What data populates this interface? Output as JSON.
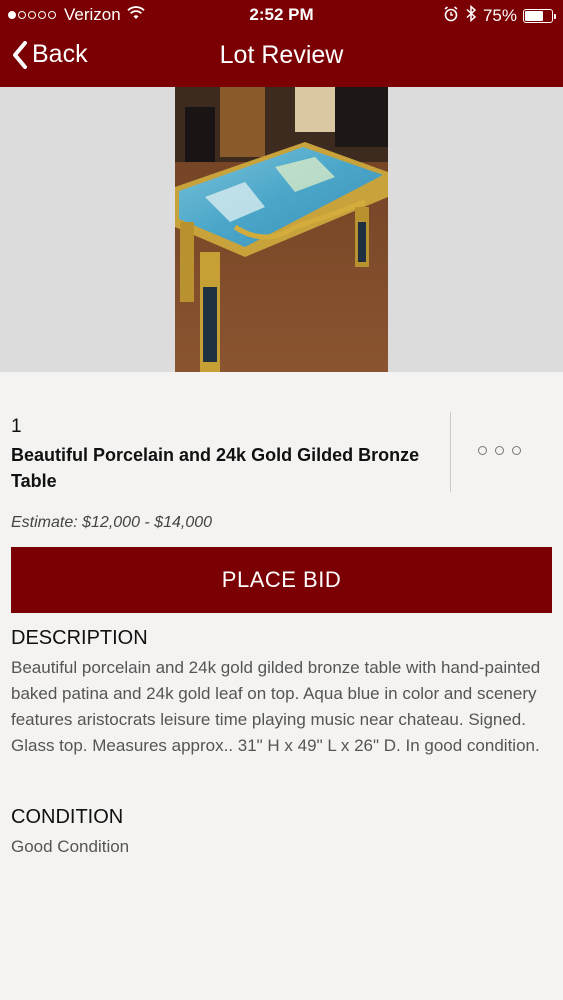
{
  "status_bar": {
    "carrier": "Verizon",
    "time": "2:52 PM",
    "battery": "75%",
    "battery_level": 0.75,
    "signal_bars_filled": 1
  },
  "nav": {
    "back_label": "Back",
    "title": "Lot Review"
  },
  "lot": {
    "number": "1",
    "title": "Beautiful Porcelain and 24k Gold Gilded Bronze Table",
    "estimate": "Estimate: $12,000 - $14,000",
    "place_bid_label": "PLACE BID"
  },
  "description": {
    "heading": "DESCRIPTION",
    "body": "Beautiful porcelain and 24k gold gilded bronze table with hand-painted baked patina and 24k gold leaf on top. Aqua blue in color and scenery features aristocrats leisure time playing music near chateau. Signed. Glass top. Measures approx.. 31\" H x 49\" L x 26\" D. In good condition."
  },
  "condition": {
    "heading": "CONDITION",
    "body": "Good Condition"
  },
  "icons": {
    "wifi": "wifi-icon",
    "alarm": "alarm-icon",
    "bluetooth": "bluetooth-icon",
    "battery": "battery-icon",
    "back": "chevron-left-icon",
    "more": "more-options-icon"
  },
  "colors": {
    "brand": "#7a0003",
    "background": "#f4f3f1"
  }
}
